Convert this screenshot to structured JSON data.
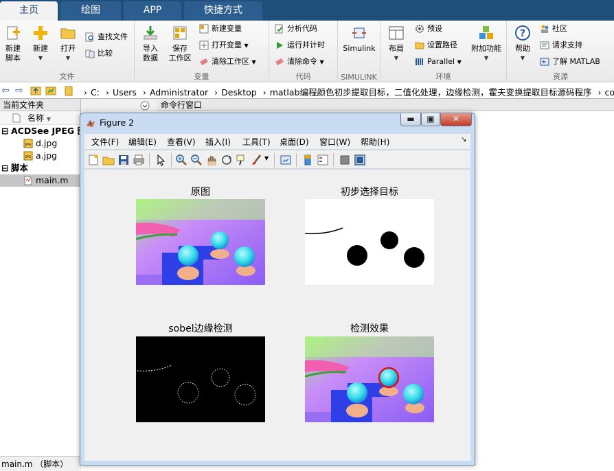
{
  "ribbon": {
    "tabs": [
      "主页",
      "绘图",
      "APP",
      "快捷方式"
    ],
    "file_group": {
      "label": "文件",
      "new_script": "新建\n脚本",
      "new": "新建",
      "open": "打开",
      "find_files": "查找文件",
      "compare": "比较"
    },
    "variable_group": {
      "label": "变量",
      "import_data": "导入\n数据",
      "save_workspace": "保存\n工作区",
      "new_variable": "新建变量",
      "open_variable": "打开变量",
      "clear_workspace": "清除工作区"
    },
    "code_group": {
      "label": "代码",
      "analyze_code": "分析代码",
      "run_and_time": "运行并计时",
      "clear_commands": "清除命令"
    },
    "simulink_group": {
      "label": "SIMULINK",
      "simulink": "Simulink"
    },
    "env_group": {
      "label": "环境",
      "layout": "布局",
      "preferences": "预设",
      "set_path": "设置路径",
      "parallel": "Parallel",
      "addons": "附加功能"
    },
    "resources_group": {
      "label": "资源",
      "help": "帮助",
      "community": "社区",
      "request_support": "请求支持",
      "learn_matlab": "了解 MATLAB"
    }
  },
  "address": {
    "segments": [
      "C:",
      "Users",
      "Administrator",
      "Desktop",
      "matlab编程颜色初步提取目标，二值化处理，边缘检测，霍夫变换提取目标源码程序",
      "code"
    ]
  },
  "current_folder": {
    "title": "当前文件夹",
    "column_name": "名称",
    "groups": [
      {
        "label": "ACDSee JPEG 图像",
        "items": [
          "d.jpg",
          "a.jpg"
        ]
      },
      {
        "label": "脚本",
        "items": [
          "main.m"
        ]
      }
    ],
    "status": "main.m （脚本）"
  },
  "command_window": {
    "title": "命令行窗口"
  },
  "figure": {
    "title": "Figure 2",
    "menu": [
      "文件(F)",
      "编辑(E)",
      "查看(V)",
      "插入(I)",
      "工具(T)",
      "桌面(D)",
      "窗口(W)",
      "帮助(H)"
    ],
    "subplots": [
      {
        "title": "原图"
      },
      {
        "title": "初步选择目标"
      },
      {
        "title": "sobel边缘检测"
      },
      {
        "title": "检测效果"
      }
    ]
  },
  "colors": {
    "tab_bar": "#1e4e79",
    "tab_active": "#f2f2f2",
    "selection": "#c6c6c6",
    "detect_circle": "#e01010",
    "ball": "#39e1e9",
    "background_purple": "#9f5df5"
  }
}
